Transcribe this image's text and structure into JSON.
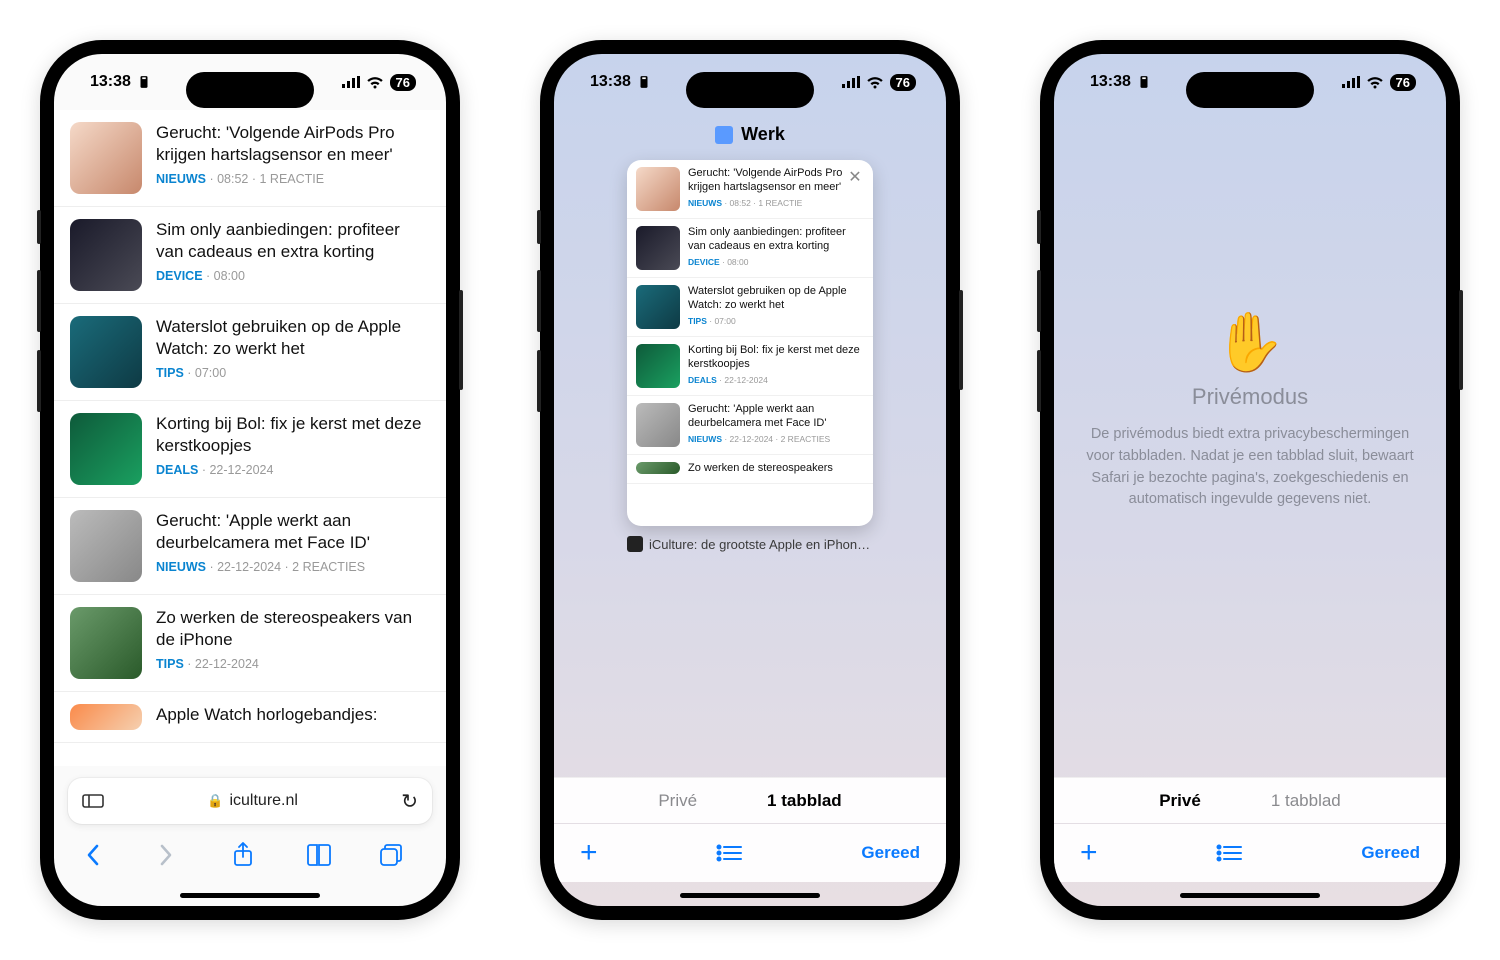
{
  "status": {
    "time": "13:38",
    "battery": "76"
  },
  "phone1": {
    "url": "iculture.nl",
    "articles": [
      {
        "title": "Gerucht: 'Volgende AirPods Pro krijgen hartslagsensor en meer'",
        "cat": "NIEUWS",
        "meta": " · 08:52 · 1 REACTIE",
        "th": "a"
      },
      {
        "title": "Sim only aanbiedingen: profiteer van cadeaus en extra korting",
        "cat": "DEVICE",
        "meta": " · 08:00",
        "th": "b"
      },
      {
        "title": "Waterslot gebruiken op de Apple Watch: zo werkt het",
        "cat": "TIPS",
        "meta": " · 07:00",
        "th": "c"
      },
      {
        "title": "Korting bij Bol: fix je kerst met deze kerstkoopjes",
        "cat": "DEALS",
        "meta": " · 22-12-2024",
        "th": "d"
      },
      {
        "title": "Gerucht: 'Apple werkt aan deurbelcamera met Face ID'",
        "cat": "NIEUWS",
        "meta": " · 22-12-2024 · 2 REACTIES",
        "th": "e"
      },
      {
        "title": "Zo werken de stereospeakers van de iPhone",
        "cat": "TIPS",
        "meta": " · 22-12-2024",
        "th": "f"
      },
      {
        "title": "Apple Watch horlogebandjes:",
        "cat": "",
        "meta": "",
        "th": "g"
      }
    ]
  },
  "phone2": {
    "group": "Werk",
    "tab_caption": "iCulture: de grootste Apple en iPhone...",
    "seg_prive": "Privé",
    "seg_tabs": "1 tabblad",
    "done": "Gereed",
    "mini": [
      {
        "title": "Gerucht: 'Volgende AirPods Pro krijgen hartslagsensor en meer'",
        "cat": "NIEUWS",
        "meta": " · 08:52 · 1 REACTIE",
        "th": "a"
      },
      {
        "title": "Sim only aanbiedingen: profiteer van cadeaus en extra korting",
        "cat": "DEVICE",
        "meta": " · 08:00",
        "th": "b"
      },
      {
        "title": "Waterslot gebruiken op de Apple Watch: zo werkt het",
        "cat": "TIPS",
        "meta": " · 07:00",
        "th": "c"
      },
      {
        "title": "Korting bij Bol: fix je kerst met deze kerstkoopjes",
        "cat": "DEALS",
        "meta": " · 22-12-2024",
        "th": "d"
      },
      {
        "title": "Gerucht: 'Apple werkt aan deurbelcamera met Face ID'",
        "cat": "NIEUWS",
        "meta": " · 22-12-2024 · 2 REACTIES",
        "th": "e"
      },
      {
        "title": "Zo werken de stereospeakers",
        "cat": "",
        "meta": "",
        "th": "f"
      }
    ]
  },
  "phone3": {
    "title": "Privémodus",
    "desc": "De privémodus biedt extra privacybeschermingen voor tabbladen. Nadat je een tabblad sluit, bewaart Safari je bezochte pagina's, zoekgeschiedenis en automatisch ingevulde gegevens niet.",
    "seg_prive": "Privé",
    "seg_tabs": "1 tabblad",
    "done": "Gereed"
  }
}
